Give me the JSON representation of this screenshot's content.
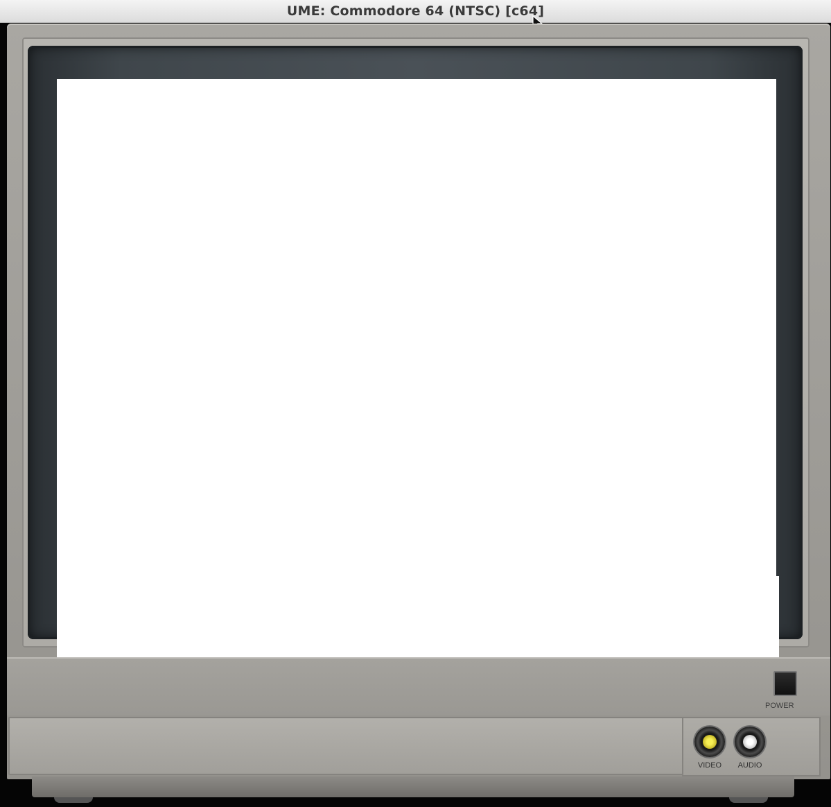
{
  "window": {
    "title": "UME: Commodore 64 (NTSC) [c64]"
  },
  "monitor": {
    "power_label": "POWER",
    "video_label": "VIDEO",
    "audio_label": "AUDIO"
  },
  "icons": {
    "cursor": "mouse-pointer-icon"
  },
  "colors": {
    "screen": "#ffffff",
    "bezel": "#3f464b",
    "case": "#9d9b96",
    "video_jack": "#f7ef55",
    "audio_jack": "#ffffff"
  }
}
